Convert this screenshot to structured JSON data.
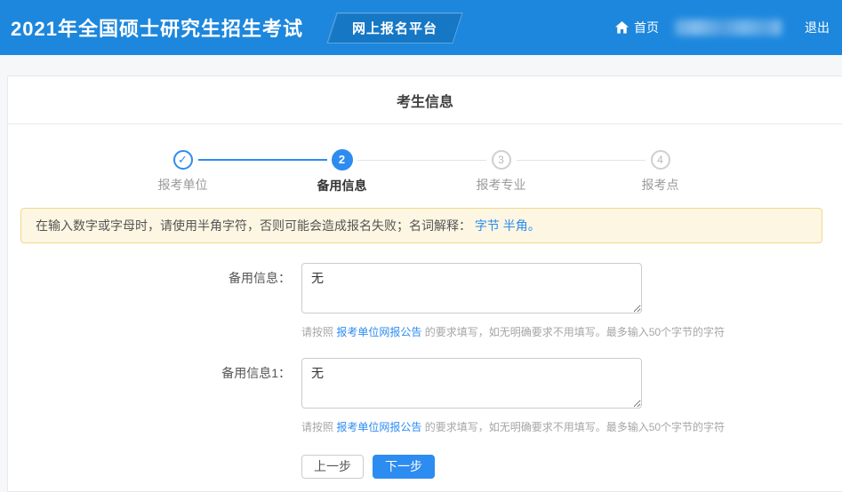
{
  "header": {
    "title": "2021年全国硕士研究生招生考试",
    "badge": "网上报名平台",
    "nav_home": "首页",
    "nav_logout": "退出"
  },
  "page": {
    "title": "考生信息"
  },
  "stepper": {
    "steps": [
      {
        "label": "报考单位",
        "state": "done",
        "icon": "check-icon"
      },
      {
        "num": "2",
        "label": "备用信息",
        "state": "active"
      },
      {
        "num": "3",
        "label": "报考专业",
        "state": "pending"
      },
      {
        "num": "4",
        "label": "报考点",
        "state": "pending"
      }
    ]
  },
  "alert": {
    "text": "在输入数字或字母时，请使用半角字符，否则可能会造成报名失败；名词解释： ",
    "link_byte": "字节",
    "link_halfwidth": "半角",
    "suffix": "。"
  },
  "form": {
    "fields": [
      {
        "label": "备用信息：",
        "value": "无"
      },
      {
        "label": "备用信息1：",
        "value": "无"
      }
    ],
    "help": {
      "prefix": "请按照 ",
      "link": "报考单位网报公告",
      "suffix": " 的要求填写，如无明确要求不用填写。最多输入50个字节的字符"
    },
    "prev_button": "上一步",
    "next_button": "下一步"
  },
  "icons": {
    "check": "✓",
    "home": "home-icon"
  },
  "colors": {
    "header_bg": "#1d87dd",
    "badge_bg": "#1677c5",
    "accent_blue": "#2d8cf0",
    "alert_bg": "#fdf6e2",
    "alert_border": "#f1d98b",
    "link_blue": "#2d8cf0",
    "pending_gray": "#cfcfcf"
  }
}
